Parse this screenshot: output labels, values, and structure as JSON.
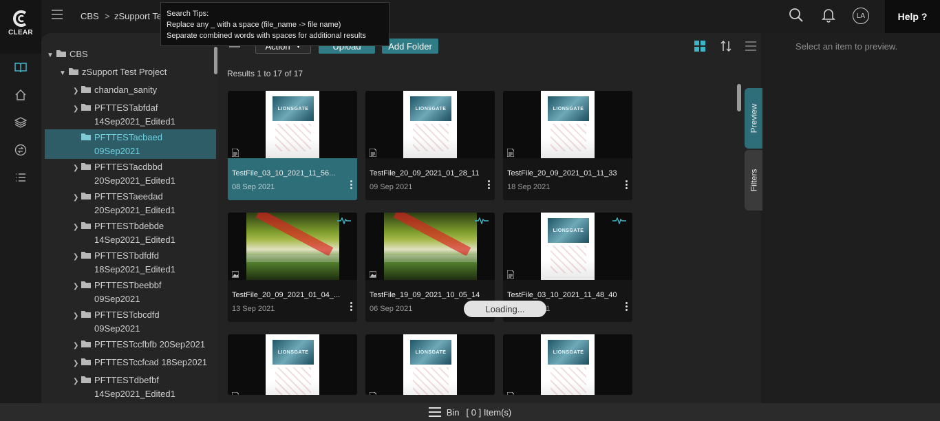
{
  "brand": {
    "name": "CLEAR"
  },
  "breadcrumb": {
    "root": "CBS",
    "sep": ">",
    "project": "zSupport Te"
  },
  "tooltip": {
    "title": "Search Tips:",
    "line1": "Replace any _ with a space (file_name -> file name)",
    "line2": "Separate combined words with spaces for additional results"
  },
  "header": {
    "avatar": "LA",
    "help": "Help ?"
  },
  "tree": {
    "root": "CBS",
    "project": "zSupport Test Project",
    "folders": [
      {
        "l1": "chandan_sanity",
        "l2": ""
      },
      {
        "l1": "PFTTESTabfdaf",
        "l2": "14Sep2021_Edited1"
      },
      {
        "l1": "PFTTESTacbaed",
        "l2": "09Sep2021"
      },
      {
        "l1": "PFTTESTacdbbd",
        "l2": "20Sep2021_Edited1"
      },
      {
        "l1": "PFTTESTaeedad",
        "l2": "20Sep2021_Edited1"
      },
      {
        "l1": "PFTTESTbdebde",
        "l2": "14Sep2021_Edited1"
      },
      {
        "l1": "PFTTESTbdfdfd",
        "l2": "18Sep2021_Edited1"
      },
      {
        "l1": "PFTTESTbeebbf",
        "l2": "09Sep2021"
      },
      {
        "l1": "PFTTESTcbcdfd",
        "l2": "09Sep2021"
      },
      {
        "l1": "PFTTESTccfbfb 20Sep2021",
        "l2": ""
      },
      {
        "l1": "PFTTESTccfcad 18Sep2021",
        "l2": ""
      },
      {
        "l1": "PFTTESTdbefbf",
        "l2": "14Sep2021_Edited1"
      }
    ]
  },
  "toolbar": {
    "action": "Action",
    "upload": "Upload",
    "add_folder": "Add Folder"
  },
  "results": "Results 1 to 17 of 17",
  "cards": [
    {
      "name": "TestFile_03_10_2021_11_56...",
      "date": "08 Sep 2021",
      "kind": "document"
    },
    {
      "name": "TestFile_20_09_2021_01_28_11",
      "date": "09 Sep 2021",
      "kind": "document"
    },
    {
      "name": "TestFile_20_09_2021_01_11_33",
      "date": "18 Sep 2021",
      "kind": "document"
    },
    {
      "name": "TestFile_20_09_2021_01_04_...",
      "date": "13 Sep 2021",
      "kind": "image"
    },
    {
      "name": "TestFile_19_09_2021_10_05_14",
      "date": "06 Sep 2021",
      "kind": "image"
    },
    {
      "name": "TestFile_03_10_2021_11_48_40",
      "date": "03 Sep 2021",
      "kind": "document"
    },
    {
      "name": "",
      "date": "",
      "kind": "document"
    },
    {
      "name": "",
      "date": "",
      "kind": "document"
    },
    {
      "name": "",
      "date": "",
      "kind": "document"
    }
  ],
  "loading": "Loading...",
  "side_tabs": {
    "preview": "Preview",
    "filters": "Filters"
  },
  "preview": {
    "placeholder": "Select an item to preview."
  },
  "footer": {
    "bin": "Bin",
    "count": "[ 0 ] Item(s)"
  },
  "colors": {
    "accent": "#2e6e79",
    "teal_button": "#2f7b86",
    "selection": "#2e5d67"
  }
}
